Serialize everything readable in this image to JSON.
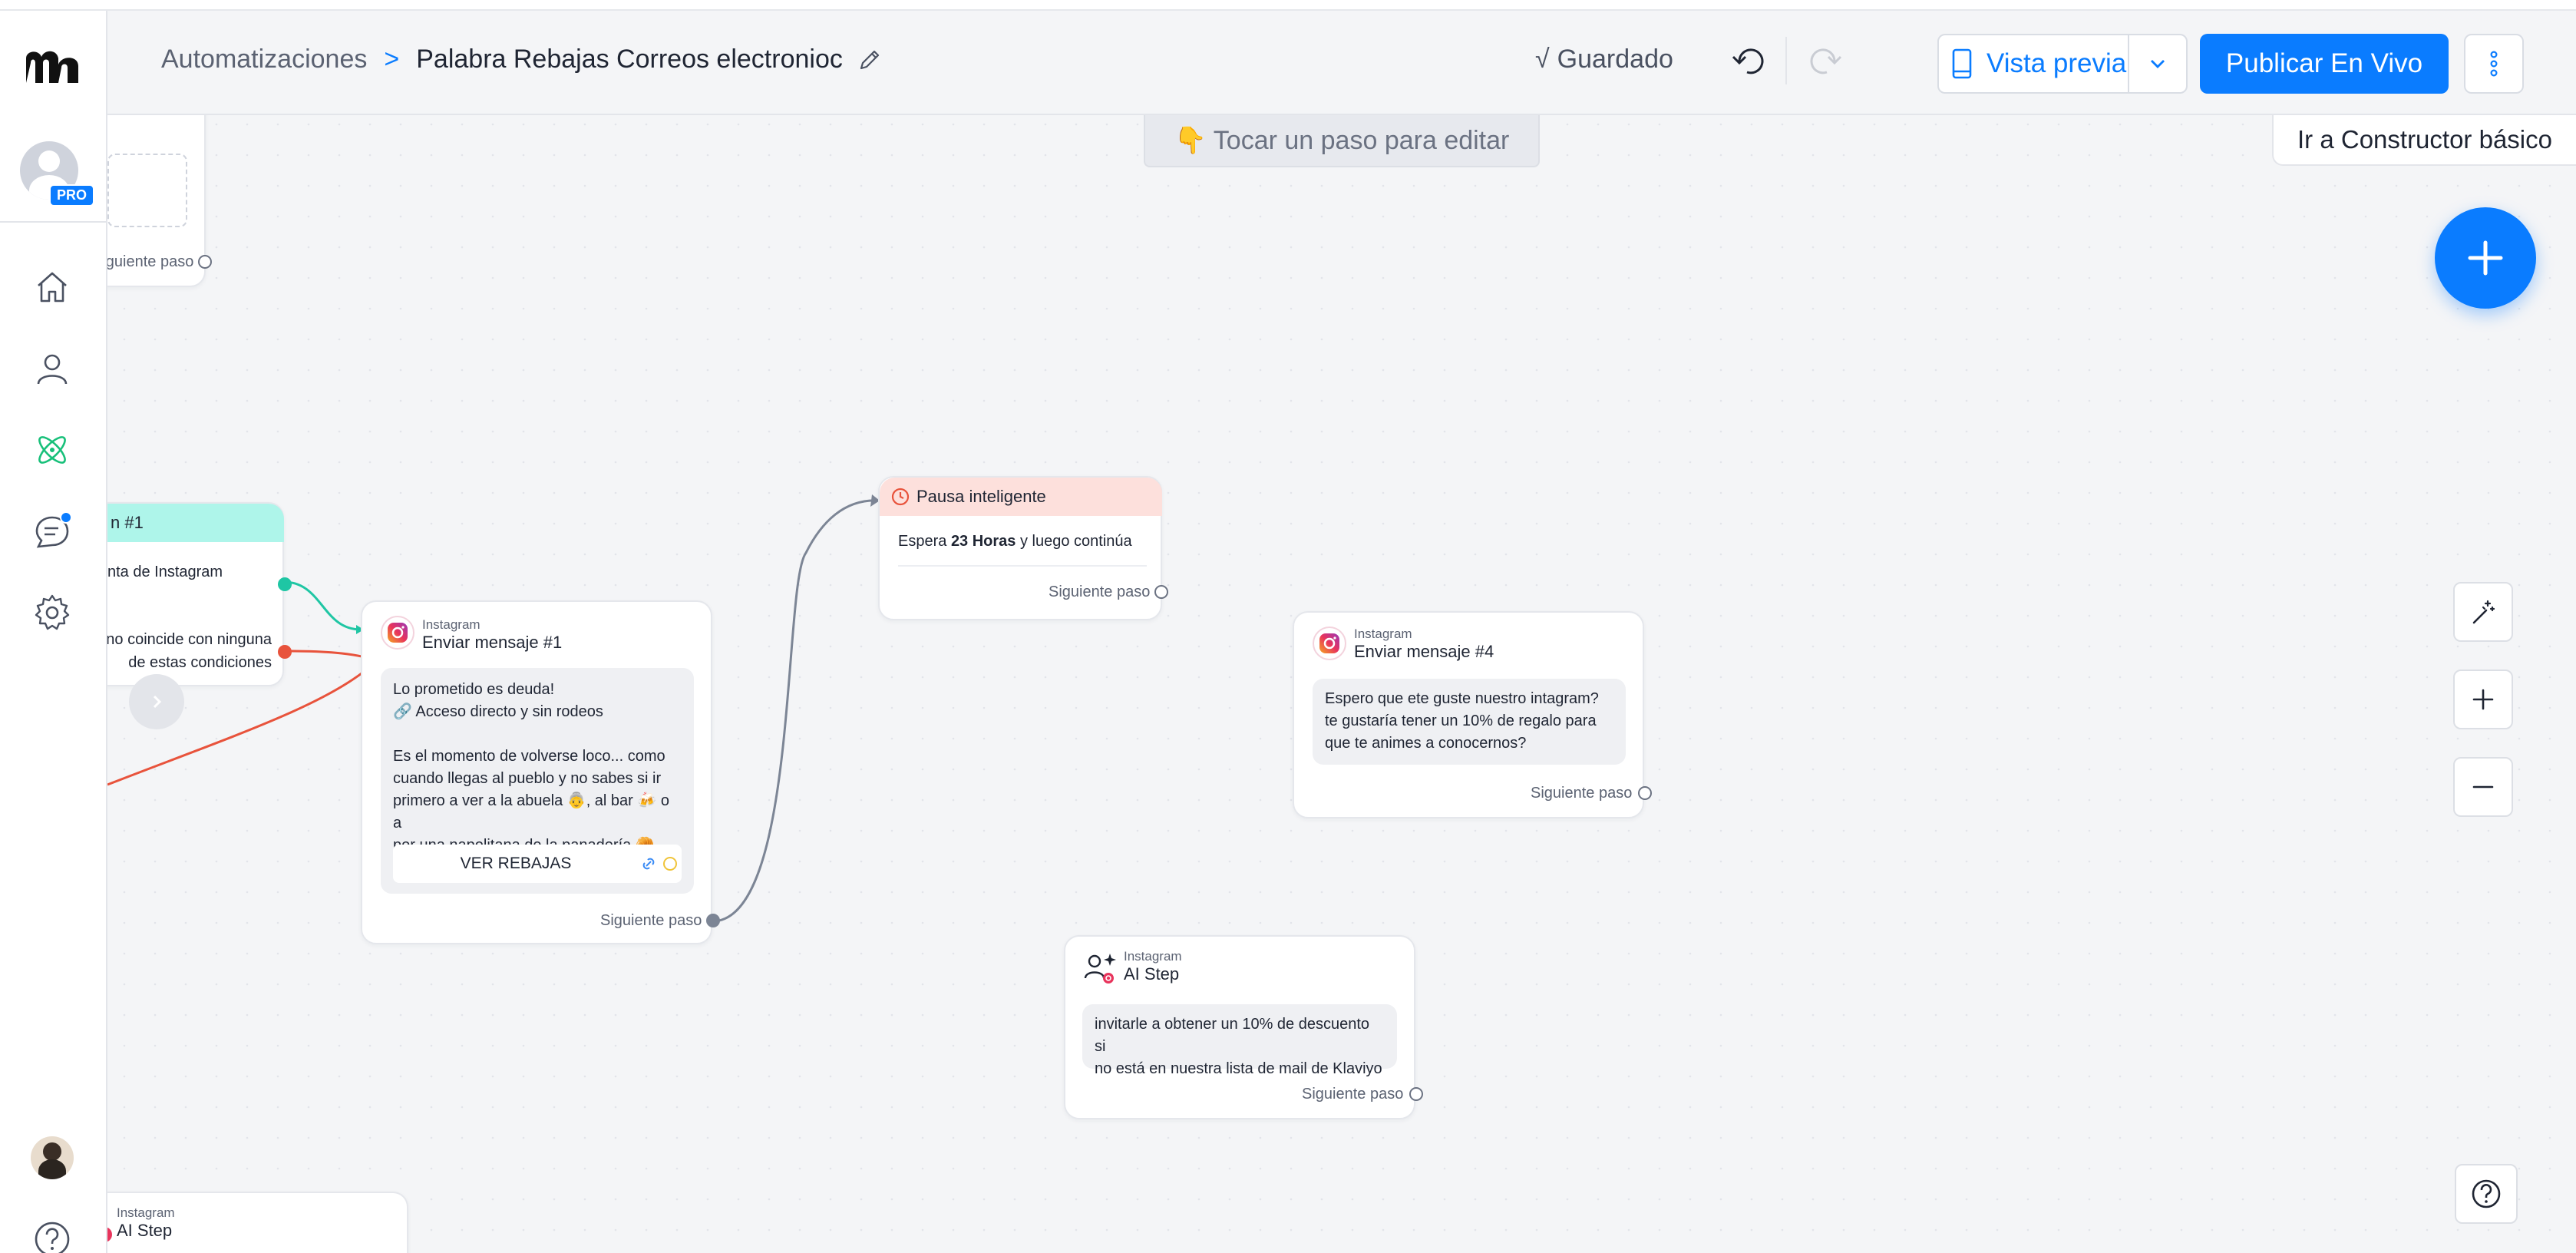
{
  "header": {
    "breadcrumb_root": "Automatizaciones",
    "breadcrumb_sep": ">",
    "breadcrumb_current": "Palabra Rebajas Correos electronioc",
    "saved_check": "√",
    "saved_label": "Guardado",
    "preview_label": "Vista previa",
    "publish_label": "Publicar En Vivo"
  },
  "sidebar": {
    "pro_badge": "PRO"
  },
  "canvas": {
    "tap_hint": "👇 Tocar un paso para editar",
    "basic_builder": "Ir a Constructor básico"
  },
  "cards": {
    "top_left": {
      "next_label": "Siguiente paso"
    },
    "trigger": {
      "title_fragment": "n #1",
      "row1": "nta de Instagram",
      "row2_line1": "no coincide con ninguna",
      "row2_line2": "de estas condiciones"
    },
    "send1": {
      "source": "Instagram",
      "title": "Enviar mensaje #1",
      "lines": [
        "Lo prometido es deuda!",
        "🔗 Acceso directo y sin rodeos",
        "",
        "Es el momento de volverse loco... como",
        "cuando llegas al pueblo y no sabes si ir",
        "primero a ver a la abuela 👵, al bar 🍻 o a",
        "por una napolitana de la panadería 🥐."
      ],
      "button_label": "VER REBAJAS",
      "next_label": "Siguiente paso"
    },
    "pause": {
      "title": "Pausa inteligente",
      "wait_prefix": "Espera",
      "wait_value": "23 Horas",
      "wait_suffix": "y luego continúa",
      "next_label": "Siguiente paso"
    },
    "send4": {
      "source": "Instagram",
      "title": "Enviar mensaje #4",
      "lines": [
        "Espero que ete guste nuestro intagram?",
        "te gustaría tener un 10% de regalo para",
        "que te animes a conocernos?"
      ],
      "next_label": "Siguiente paso"
    },
    "ai_step": {
      "source": "Instagram",
      "title": "AI Step",
      "lines": [
        "invitarle a obtener un 10% de descuento si",
        "no está en nuestra lista de mail de Klaviyo"
      ],
      "next_label": "Siguiente paso"
    },
    "ai_step_bottom": {
      "source": "Instagram",
      "title": "AI Step"
    }
  },
  "colors": {
    "accent": "#0a7cff",
    "trigger_header": "#aef5ea",
    "pause_header": "#fde0dc",
    "edge_teal": "#1fc6a4",
    "edge_red": "#e8533c",
    "edge_gray": "#7c8595",
    "nav_active": "#18c07a"
  },
  "icons": {
    "logo": "manychat-logo",
    "home": "home-icon",
    "contacts": "user-icon",
    "automation": "atom-icon",
    "chat": "chat-icon",
    "settings": "gear-icon",
    "help": "question-icon"
  }
}
